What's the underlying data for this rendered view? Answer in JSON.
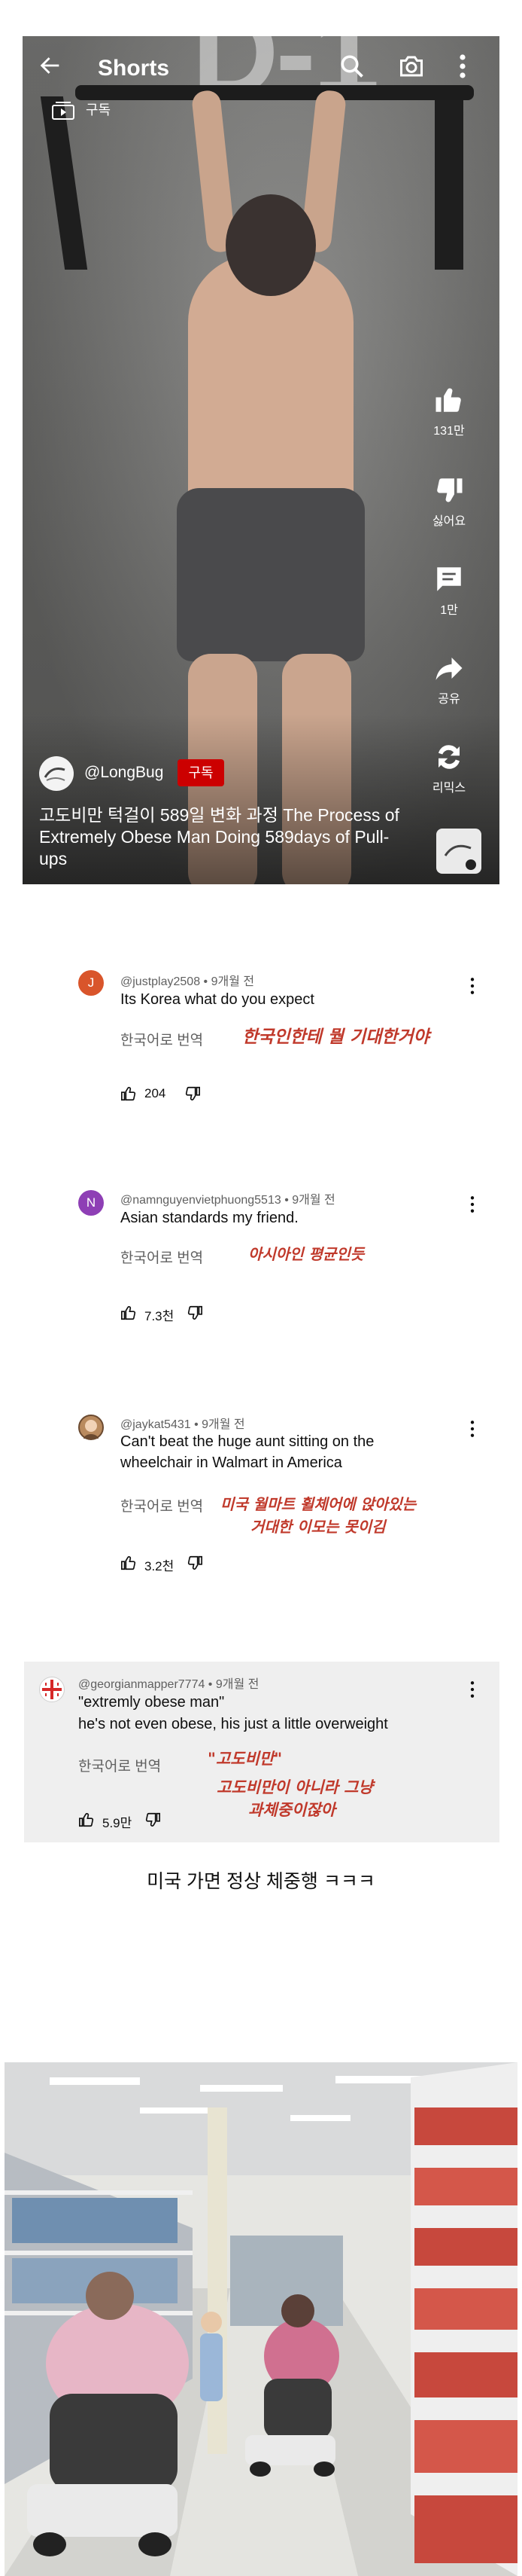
{
  "player": {
    "title": "Shorts",
    "background_text": "D-1",
    "subscribe_chip": "구독",
    "actions": [
      {
        "icon": "like-icon",
        "label": "131만"
      },
      {
        "icon": "dislike-icon",
        "label": "싫어요"
      },
      {
        "icon": "comment-icon",
        "label": "1만"
      },
      {
        "icon": "share-icon",
        "label": "공유"
      },
      {
        "icon": "remix-icon",
        "label": "리믹스"
      }
    ],
    "channel": "@LongBug",
    "subscribe_label": "구독",
    "caption": "고도비만 턱걸이 589일 변화 과정 The Process of Extremely Obese Man Doing 589days of Pull-ups"
  },
  "comments": [
    {
      "avatar_letter": "J",
      "avatar_color": "#d9552b",
      "meta": "@justplay2508 • 9개월 전",
      "text": "Its Korea what do you expect",
      "translate": "한국어로 번역",
      "note": "한국인한테 뭘 기대한거야",
      "likes": "204"
    },
    {
      "avatar_letter": "N",
      "avatar_color": "#8e3fb5",
      "meta": "@namnguyenvietphuong5513 • 9개월 전",
      "text": "Asian standards my friend.",
      "translate": "한국어로 번역",
      "note": "아시아인 평균인듯",
      "likes": "7.3천"
    },
    {
      "avatar_letter": "",
      "avatar_color": "#b98a5e",
      "meta": "@jaykat5431 • 9개월 전",
      "text": "Can't beat the huge aunt sitting on the wheelchair in Walmart in America",
      "translate": "한국어로 번역",
      "note_line1": "미국 월마트 휠체어에 앉아있는",
      "note_line2": "거대한 이모는 못이김",
      "likes": "3.2천"
    },
    {
      "avatar_letter": "",
      "avatar_color": "#ffffff",
      "meta": "@georgianmapper7774 • 9개월 전",
      "text_line1": "\"extremly obese man\"",
      "text_line2": "he's not even obese, his just a little overweight",
      "translate": "한국어로 번역",
      "note_line1": "\"고도비만\"",
      "note_line2": "고도비만이 아니라 그냥",
      "note_line3": "과체중이잖아",
      "likes": "5.9만"
    }
  ],
  "summary": "미국 가면 정상 체중행 ㅋㅋㅋ",
  "colors": {
    "subscribe_red": "#cc0000",
    "note_red": "#c0392b",
    "meta_gray": "#606060"
  }
}
